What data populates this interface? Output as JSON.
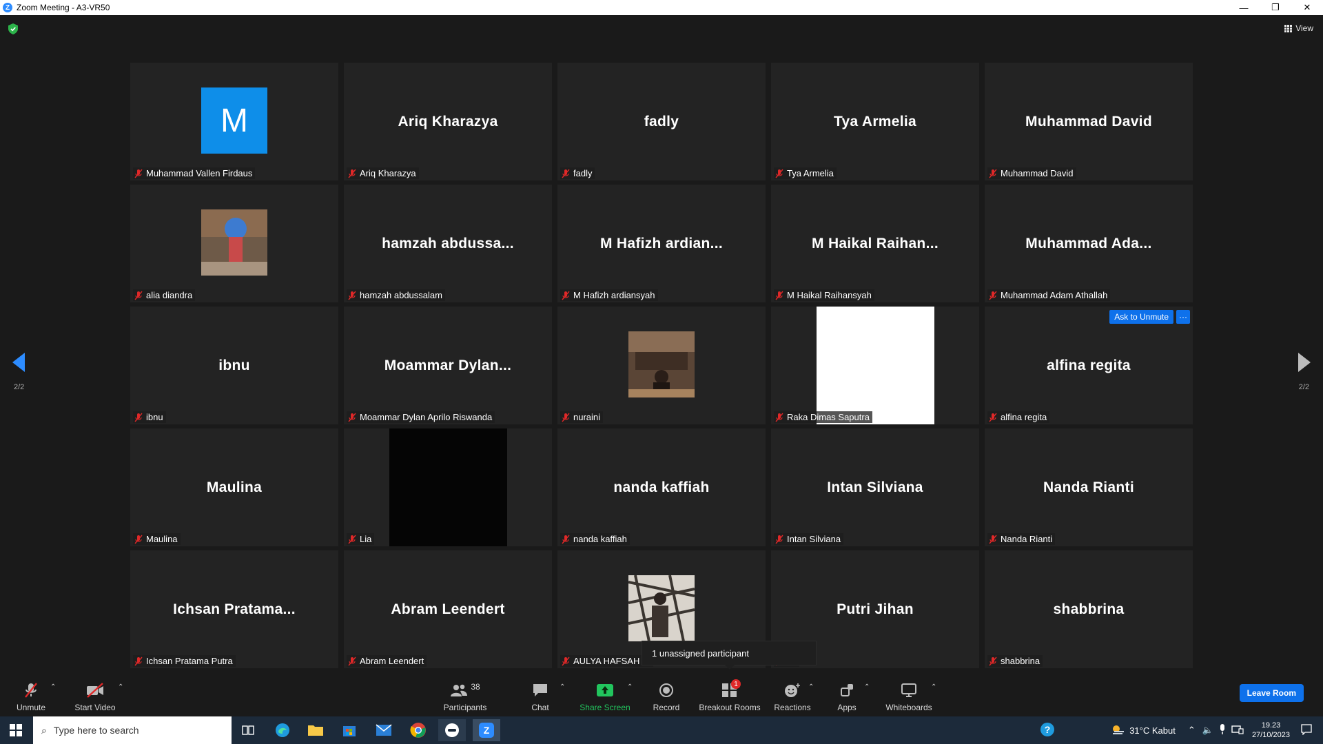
{
  "window": {
    "title": "Zoom Meeting - A3-VR50",
    "min": "—",
    "restore": "❐",
    "close": "✕"
  },
  "view_label": "View",
  "pagination": {
    "left": "2/2",
    "right": "2/2"
  },
  "tiles": [
    {
      "big": "",
      "label": "Muhammad Vallen Firdaus",
      "avatar_letter": "M"
    },
    {
      "big": "Ariq Kharazya",
      "label": "Ariq Kharazya"
    },
    {
      "big": "fadly",
      "label": "fadly"
    },
    {
      "big": "Tya Armelia",
      "label": "Tya Armelia"
    },
    {
      "big": "Muhammad David",
      "label": "Muhammad David"
    },
    {
      "big": "",
      "label": "alia diandra"
    },
    {
      "big": "hamzah abdussa...",
      "label": "hamzah abdussalam"
    },
    {
      "big": "M Hafizh ardian...",
      "label": "M Hafizh ardiansyah"
    },
    {
      "big": "M Haikal Raihan...",
      "label": "M Haikal Raihansyah"
    },
    {
      "big": "Muhammad Ada...",
      "label": "Muhammad Adam Athallah"
    },
    {
      "big": "ibnu",
      "label": "ibnu"
    },
    {
      "big": "Moammar Dylan...",
      "label": "Moammar Dylan Aprilo Riswanda"
    },
    {
      "big": "",
      "label": "nuraini"
    },
    {
      "big": "",
      "label": "Raka Dimas Saputra"
    },
    {
      "big": "alfina regita",
      "label": "alfina regita"
    },
    {
      "big": "Maulina",
      "label": "Maulina"
    },
    {
      "big": "",
      "label": "Lia"
    },
    {
      "big": "nanda kaffiah",
      "label": "nanda kaffiah"
    },
    {
      "big": "Intan Silviana",
      "label": "Intan Silviana"
    },
    {
      "big": "Nanda Rianti",
      "label": "Nanda Rianti"
    },
    {
      "big": "Ichsan Pratama...",
      "label": "Ichsan Pratama Putra"
    },
    {
      "big": "Abram Leendert",
      "label": "Abram Leendert"
    },
    {
      "big": "",
      "label": "AULYA HAFSAH W"
    },
    {
      "big": "Putri Jihan",
      "label": "an"
    },
    {
      "big": "shabbrina",
      "label": "shabbrina"
    }
  ],
  "ask_unmute": "Ask to Unmute",
  "more_label": "···",
  "tooltip": "1 unassigned participant",
  "toolbar": {
    "unmute": "Unmute",
    "start_video": "Start Video",
    "participants": "Participants",
    "participants_count": "38",
    "chat": "Chat",
    "share_screen": "Share Screen",
    "record": "Record",
    "breakout_rooms": "Breakout Rooms",
    "breakout_badge": "1",
    "reactions": "Reactions",
    "apps": "Apps",
    "whiteboards": "Whiteboards",
    "leave": "Leave Room"
  },
  "taskbar": {
    "search_placeholder": "Type here to search",
    "weather": "31°C  Kabut",
    "time": "19.23",
    "date": "27/10/2023"
  },
  "colors": {
    "accent": "#0e71eb",
    "zoom_blue": "#2d8cff",
    "muted_red": "#e02828",
    "share_green": "#22c55e"
  }
}
